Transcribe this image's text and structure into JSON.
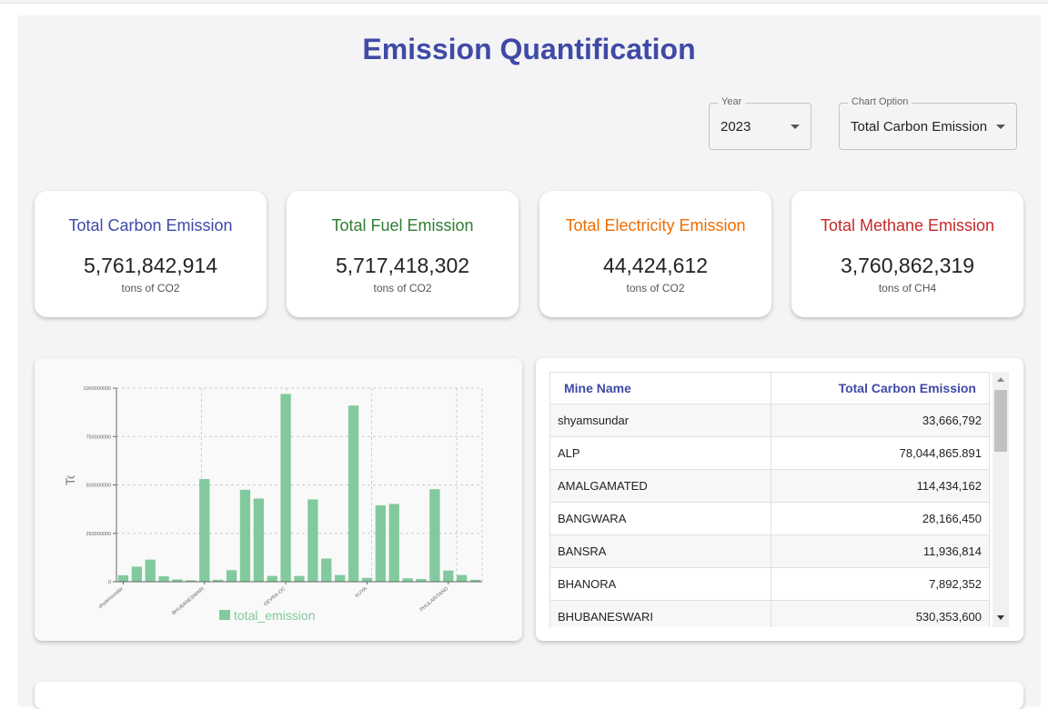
{
  "page": {
    "title": "Emission Quantification"
  },
  "filters": {
    "year": {
      "label": "Year",
      "value": "2023"
    },
    "chart_option": {
      "label": "Chart Option",
      "value": "Total Carbon Emission"
    }
  },
  "cards": [
    {
      "title": "Total Carbon Emission",
      "value": "5,761,842,914",
      "unit": "tons of CO2",
      "color": "#3f4aa6"
    },
    {
      "title": "Total Fuel Emission",
      "value": "5,717,418,302",
      "unit": "tons of CO2",
      "color": "#2e7d32"
    },
    {
      "title": "Total Electricity Emission",
      "value": "44,424,612",
      "unit": "tons of CO2",
      "color": "#ef6c00"
    },
    {
      "title": "Total Methane Emission",
      "value": "3,760,862,319",
      "unit": "tons of CH4",
      "color": "#c62828"
    }
  ],
  "chart_data": {
    "type": "bar",
    "ylabel": "Total Carbon Emissi",
    "xlabel": "",
    "ylim": [
      0,
      1000000000
    ],
    "yticks": [
      0,
      250000000,
      500000000,
      750000000,
      1000000000
    ],
    "ytick_labels": [
      "0",
      "250000000",
      "500000000",
      "750000000",
      "1000000000"
    ],
    "grid": true,
    "legend": "bottom",
    "color": "#82ca9d",
    "categories": [
      "shyamsundar",
      "",
      "",
      "",
      "",
      "",
      "BHUBANESWARI",
      "",
      "",
      "",
      "",
      "",
      "GEVRA-OC",
      "",
      "",
      "",
      "",
      "",
      "KUYA",
      "",
      "",
      "",
      "",
      "",
      "PHULARITAND",
      "",
      "",
      ""
    ],
    "series": [
      {
        "name": "total_emission",
        "values": [
          33666792,
          78044866,
          114434162,
          28166450,
          11936814,
          7892352,
          530353600,
          10000000,
          60000000,
          475000000,
          430000000,
          30000000,
          970000000,
          30000000,
          425000000,
          120000000,
          35000000,
          910000000,
          20000000,
          395000000,
          402000000,
          18000000,
          14000000,
          478000000,
          58000000,
          35000000,
          10000000
        ]
      }
    ]
  },
  "table": {
    "headers": [
      "Mine Name",
      "Total Carbon Emission"
    ],
    "rows": [
      [
        "shyamsundar",
        "33,666,792"
      ],
      [
        "ALP",
        "78,044,865.891"
      ],
      [
        "AMALGAMATED",
        "114,434,162"
      ],
      [
        "BANGWARA",
        "28,166,450"
      ],
      [
        "BANSRA",
        "11,936,814"
      ],
      [
        "BHANORA",
        "7,892,352"
      ],
      [
        "BHUBANESWARI",
        "530,353,600"
      ]
    ]
  }
}
